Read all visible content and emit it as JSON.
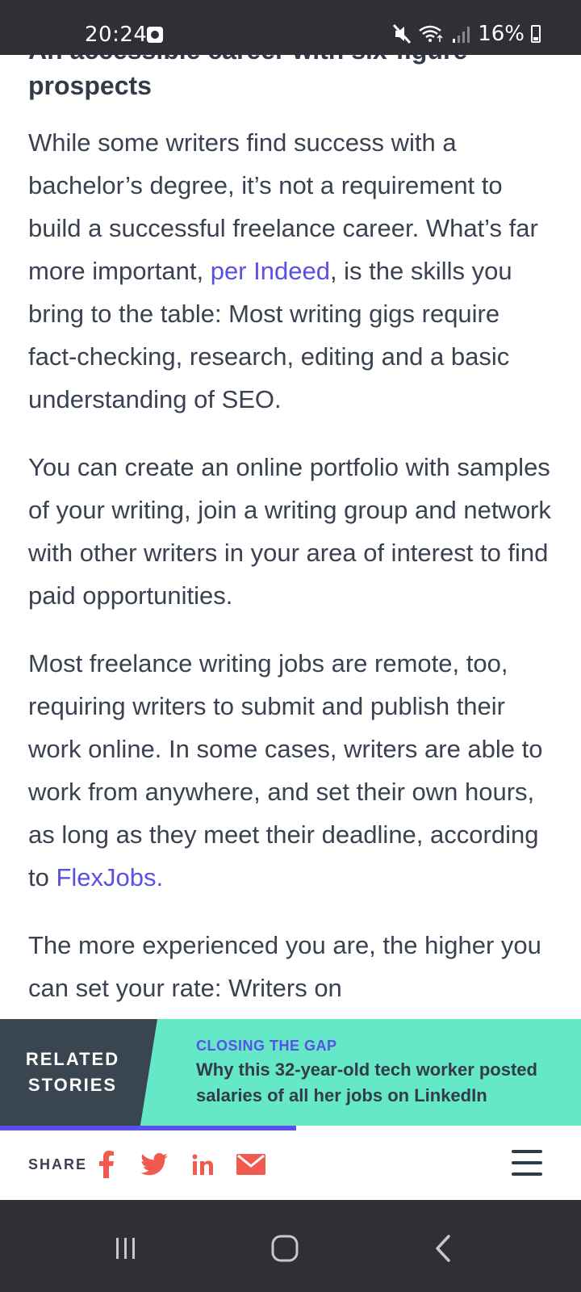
{
  "status_bar": {
    "time": "20:24",
    "battery": "16%"
  },
  "article": {
    "heading": "An accessible career with six-figure prospects",
    "paragraphs": [
      {
        "before": "While some writers find success with a bachelor’s degree, it’s not a requirement to build a successful freelance career. What’s far more important, ",
        "link": "per Indeed",
        "after": ", is the skills you bring to the table: Most writing gigs require fact-checking, research, editing and a basic understanding of SEO."
      },
      {
        "text": "You can create an online portfolio with samples of your writing, join a writing group and network with other writers in your area of interest to find paid opportunities."
      },
      {
        "before": "Most freelance writing jobs are remote, too, requiring writers to submit and publish their work online. In some cases, writers are able to work from anywhere, and set their own hours, as long as they meet their deadline, according to ",
        "link": "FlexJobs.",
        "after": ""
      },
      {
        "text": "The more experienced you are, the higher you can set your rate: Writers on"
      }
    ]
  },
  "related": {
    "label_line1": "RELATED",
    "label_line2": "STORIES",
    "kicker": "CLOSING THE GAP",
    "title_line1": "Why this 32-year-old tech worker posted",
    "title_line2": "salaries of all her jobs on LinkedIn",
    "reading_progress": 0.51
  },
  "share": {
    "label": "SHARE",
    "icons": [
      "facebook-icon",
      "twitter-icon",
      "linkedin-icon",
      "email-icon"
    ]
  },
  "colors": {
    "accent": "#5b50e6",
    "share_icons": "#f05a4f",
    "related_bg": "#64e8c8",
    "related_label_bg": "#3a4552",
    "text": "#3a4150"
  }
}
